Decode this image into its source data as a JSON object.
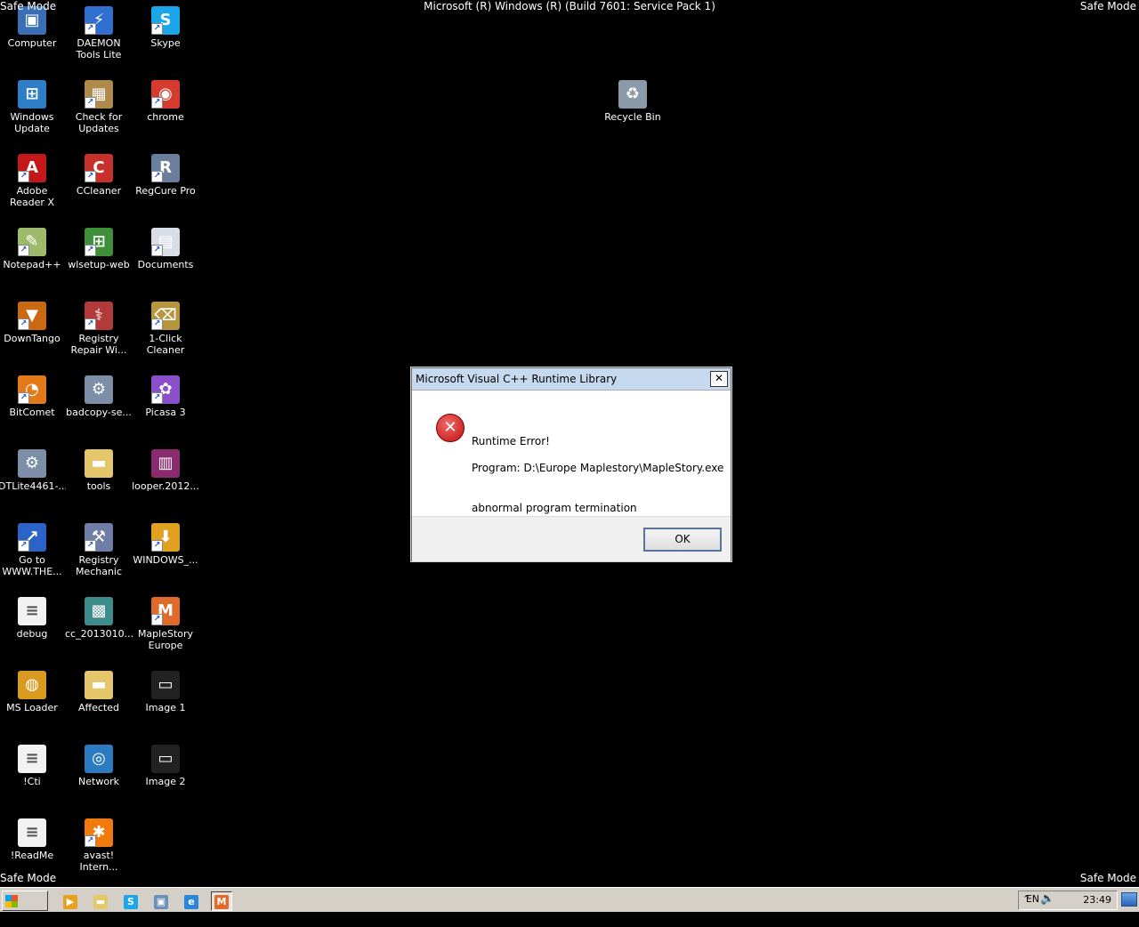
{
  "header": {
    "safe_mode_label": "Safe Mode",
    "build_text": "Microsoft (R) Windows (R) (Build 7601: Service Pack 1)"
  },
  "desktop": {
    "icons": [
      {
        "label": "Computer",
        "icon": "computer-icon"
      },
      {
        "label": "DAEMON\nTools Lite",
        "icon": "daemon-tools-icon"
      },
      {
        "label": "Skype",
        "icon": "skype-icon"
      },
      {
        "label": "Windows\nUpdate",
        "icon": "windows-update-icon"
      },
      {
        "label": "Check for\nUpdates",
        "icon": "package-icon"
      },
      {
        "label": "chrome",
        "icon": "chrome-icon"
      },
      {
        "label": "Adobe\nReader X",
        "icon": "pdf-icon"
      },
      {
        "label": "CCleaner",
        "icon": "ccleaner-icon"
      },
      {
        "label": "RegCure Pro",
        "icon": "regcure-icon"
      },
      {
        "label": "Notepad++",
        "icon": "notepad-icon"
      },
      {
        "label": "wlsetup-web",
        "icon": "windows-flag-icon"
      },
      {
        "label": "Documents",
        "icon": "documents-icon"
      },
      {
        "label": "DownTango",
        "icon": "downtango-icon"
      },
      {
        "label": "Registry\nRepair Wi...",
        "icon": "registry-repair-icon"
      },
      {
        "label": "1-Click\nCleaner",
        "icon": "cleaner-icon"
      },
      {
        "label": "BitComet",
        "icon": "bitcomet-icon"
      },
      {
        "label": "badcopy-se...",
        "icon": "installer-icon"
      },
      {
        "label": "Picasa 3",
        "icon": "picasa-icon"
      },
      {
        "label": "DTLite4461-...",
        "icon": "installer-icon"
      },
      {
        "label": "tools",
        "icon": "folder-icon"
      },
      {
        "label": "looper.2012...",
        "icon": "archive-icon"
      },
      {
        "label": "Go to\nWWW.THE...",
        "icon": "link-icon"
      },
      {
        "label": "Registry\nMechanic",
        "icon": "registry-mechanic-icon"
      },
      {
        "label": "WINDOWS_...",
        "icon": "download-icon"
      },
      {
        "label": "debug",
        "icon": "text-file-icon"
      },
      {
        "label": "cc_2013010...",
        "icon": "registry-file-icon"
      },
      {
        "label": "MapleStory\nEurope",
        "icon": "maplestory-icon"
      },
      {
        "label": "MS Loader",
        "icon": "globe-icon"
      },
      {
        "label": "Affected",
        "icon": "folder-icon"
      },
      {
        "label": "Image 1",
        "icon": "image-icon"
      },
      {
        "label": "!Cti",
        "icon": "text-file-icon"
      },
      {
        "label": "Network",
        "icon": "network-icon"
      },
      {
        "label": "Image 2",
        "icon": "image-icon"
      },
      {
        "label": "!ReadMe",
        "icon": "text-file-icon"
      },
      {
        "label": "avast!\nIntern...",
        "icon": "avast-icon"
      }
    ],
    "recycle_bin": {
      "label": "Recycle Bin",
      "icon": "recycle-bin-icon"
    }
  },
  "dialog": {
    "title": "Microsoft Visual C++ Runtime Library",
    "close_symbol": "✕",
    "line1": "Runtime Error!",
    "line2": "Program: D:\\Europe Maplestory\\MapleStory.exe",
    "line3": "abnormal program termination",
    "ok_label": "OK"
  },
  "taskbar": {
    "start_label": "Start",
    "language": "EN",
    "clock": "23:49",
    "pinned": [
      "media-player-icon",
      "explorer-icon",
      "skype-icon",
      "monitor-icon",
      "ie-icon",
      "maplestory-icon"
    ]
  }
}
